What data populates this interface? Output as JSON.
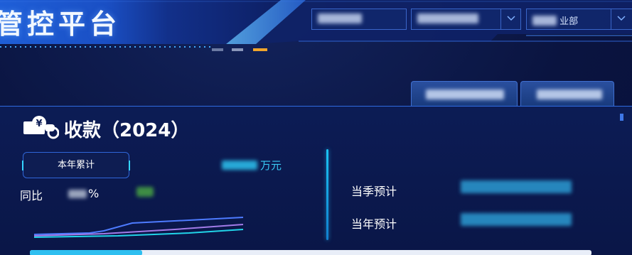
{
  "header": {
    "title": "管控平台",
    "filter_1": "",
    "filter_2": "",
    "filter_3": "业部"
  },
  "card": {
    "title": "收款（2024）",
    "icon": "yen-hand-icon",
    "ytd_button": "本年累计",
    "amount_unit": "万元",
    "yoy_label": "同比",
    "yoy_unit": "%",
    "quarter_forecast_label": "当季预计",
    "year_forecast_label": "当年预计",
    "progress": 0.2
  },
  "colors": {
    "accent": "#2fbff0",
    "border": "#2f66d8",
    "background": "#0a1440"
  }
}
